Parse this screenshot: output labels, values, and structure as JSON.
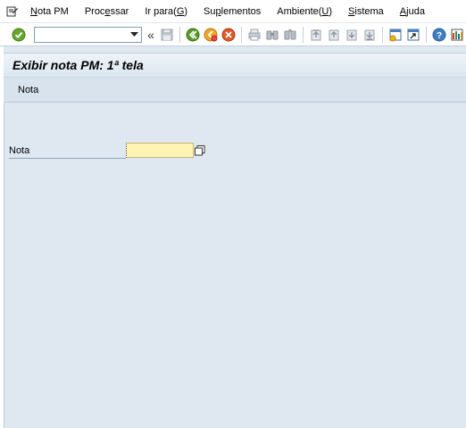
{
  "menubar": {
    "items": [
      {
        "pre": "",
        "ul": "N",
        "post": "ota PM"
      },
      {
        "pre": "Proc",
        "ul": "e",
        "post": "ssar"
      },
      {
        "pre": "Ir para(",
        "ul": "G",
        "post": ")"
      },
      {
        "pre": "Su",
        "ul": "p",
        "post": "lementos"
      },
      {
        "pre": "Ambiente(",
        "ul": "U",
        "post": ")"
      },
      {
        "pre": "",
        "ul": "S",
        "post": "istema"
      },
      {
        "pre": "",
        "ul": "A",
        "post": "juda"
      }
    ]
  },
  "toolbar": {
    "command_value": "",
    "chevron": "«"
  },
  "title": "Exibir nota PM: 1ª tela",
  "app_toolbar": {
    "nota_button": "Nota"
  },
  "form": {
    "nota_label": "Nota",
    "nota_value": ""
  }
}
